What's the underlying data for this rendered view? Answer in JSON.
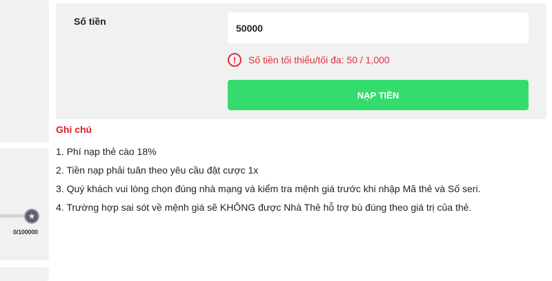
{
  "sidebar": {
    "progress": {
      "current": 0,
      "max": 100000,
      "text": "0/100000",
      "fraction": 0.0
    },
    "rank_icon": "star-badge-icon"
  },
  "form": {
    "amount_label": "Số tiền",
    "amount_value": "50000",
    "error_icon": "alert-circle-icon",
    "error_text": "Số tiền tối thiểu/tối đa: 50 / 1,000",
    "submit_label": "NẠP TIỀN",
    "submit_color": "#34dc6e",
    "error_color": "#e0303a"
  },
  "notes": {
    "title": "Ghi chú",
    "items": [
      "1. Phí nạp thẻ cào 18%",
      "2. Tiền nạp phải tuân theo yêu cầu đặt cược 1x",
      "3. Quý khách vui lòng chọn đúng nhà mạng và kiểm tra mệnh giá trước khi nhập Mã thẻ và Số seri.",
      "4. Trường hợp sai sót về mệnh giá sẽ KHÔNG được Nhà Thẻ hỗ trợ bù đúng theo giá trị của thẻ."
    ]
  }
}
